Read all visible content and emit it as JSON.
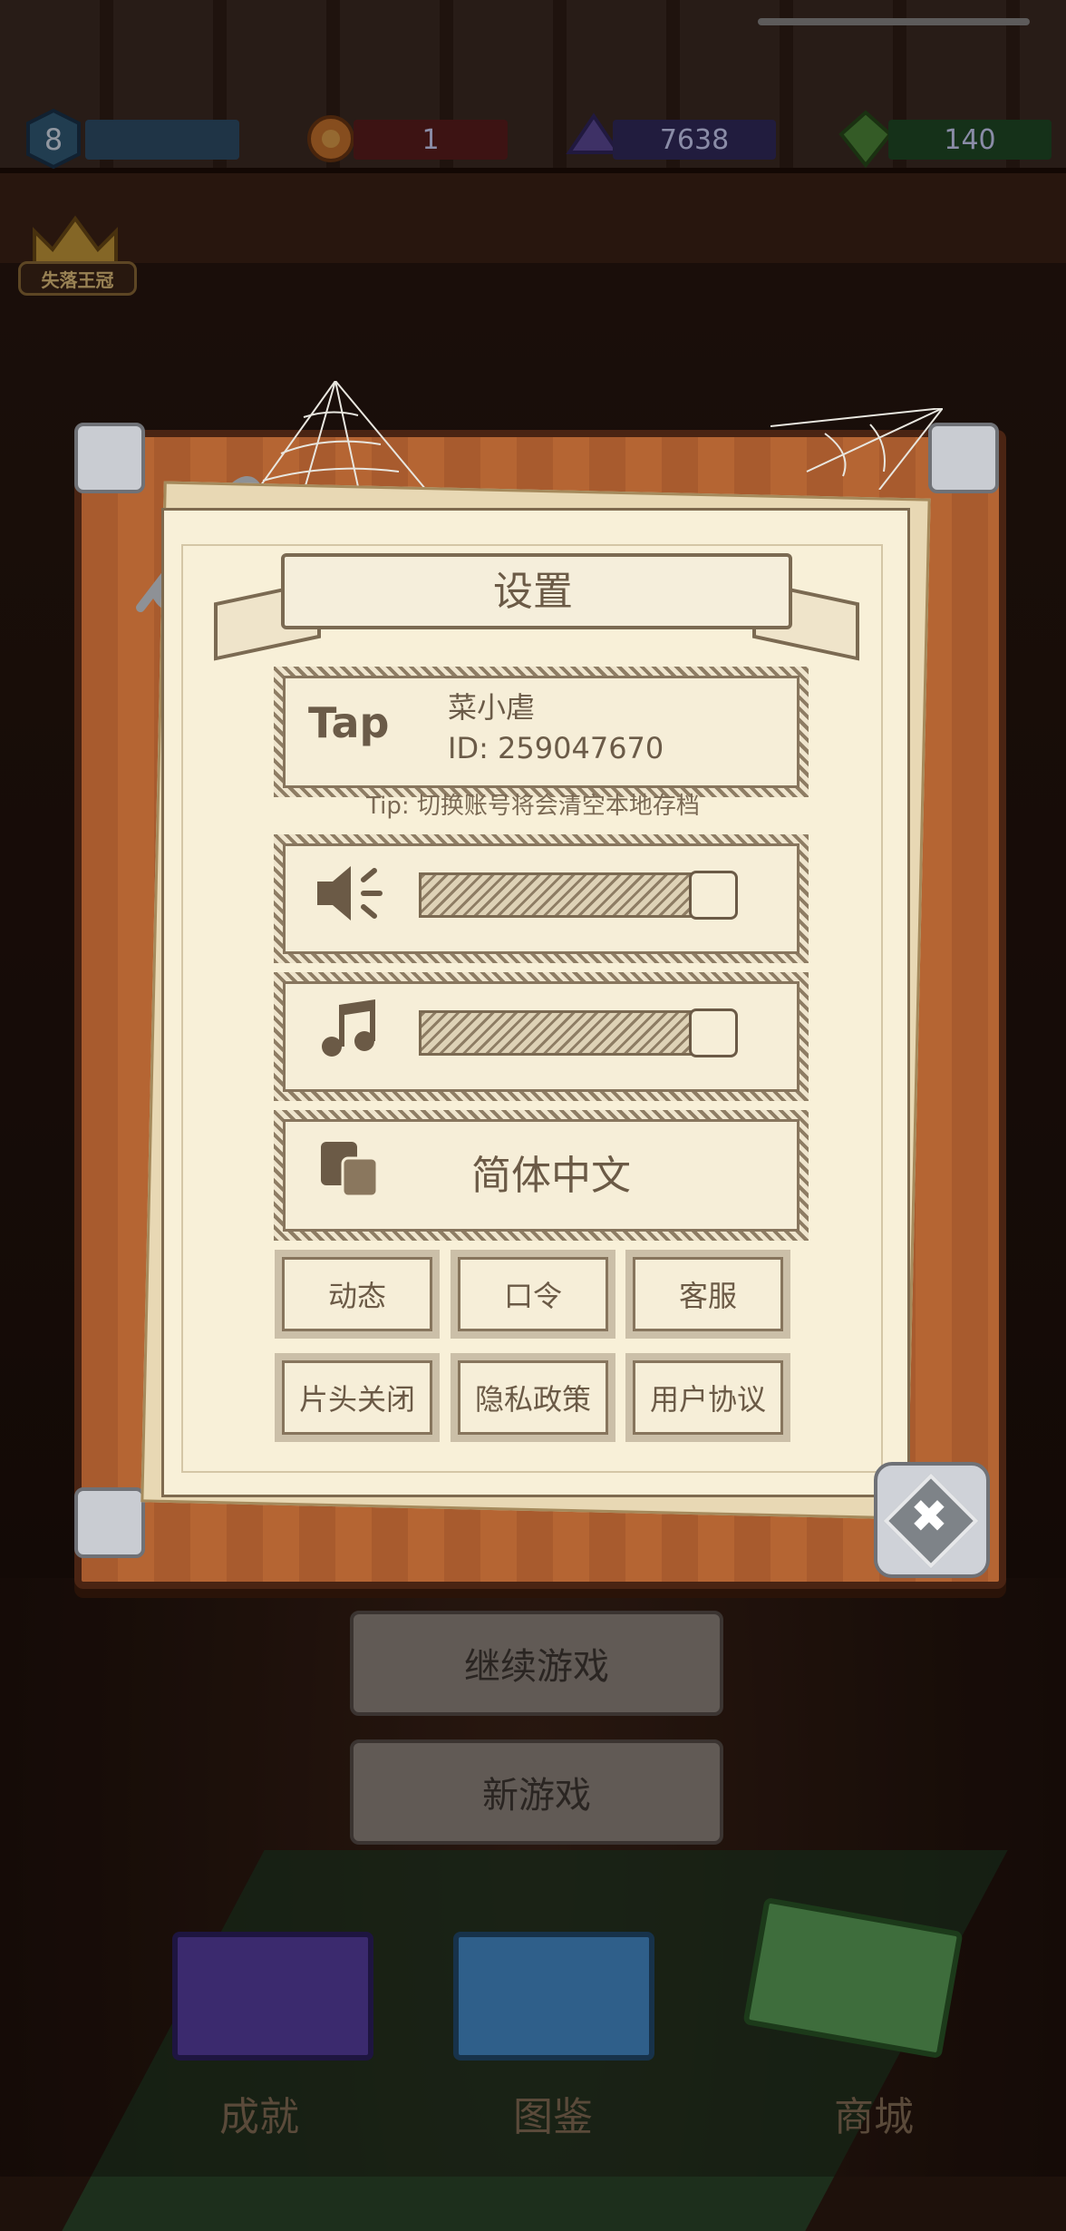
{
  "status_bar": {
    "level": "8",
    "ruby_count": "1",
    "gem_count": "7638",
    "diamond_count": "140"
  },
  "crown": {
    "label": "失落王冠"
  },
  "settings": {
    "title": "设置",
    "account": {
      "logo": "Tap",
      "username": "菜小虐",
      "user_id": "ID:  259047670"
    },
    "tip": "Tip: 切换账号将会清空本地存档",
    "sound_volume": 1.0,
    "music_volume": 1.0,
    "language": "简体中文",
    "buttons": {
      "dynamic": "动态",
      "password": "口令",
      "support": "客服",
      "intro_off": "片头关闭",
      "privacy": "隐私政策",
      "user_agreement": "用户协议"
    }
  },
  "menu": {
    "continue": "继续游戏",
    "new_game": "新游戏"
  },
  "bottom_nav": {
    "achievements": "成就",
    "codex": "图鉴",
    "shop": "商城"
  },
  "colors": {
    "paper": "#f8f0d8",
    "board": "#a85b2e",
    "ink": "#6b5a46"
  }
}
